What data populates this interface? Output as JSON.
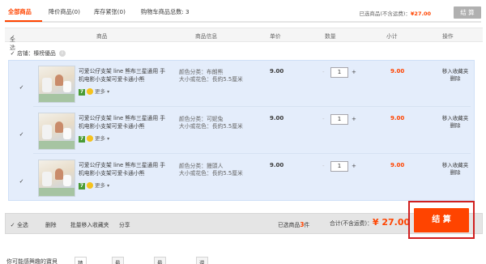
{
  "tabs": [
    {
      "label": "全部商品"
    },
    {
      "label": "降价商品(0)"
    },
    {
      "label": "库存紧张(0)"
    },
    {
      "label": "购物车商品总数: 3"
    }
  ],
  "summary": {
    "label": "已选商品(不含运费)：",
    "amount": "¥27.00",
    "pay": "结 算"
  },
  "thead": {
    "select_all": "全选",
    "product": "商品",
    "info": "商品信息",
    "price": "单价",
    "qty": "数量",
    "subtotal": "小计",
    "ops": "操作"
  },
  "shop": {
    "label": "店铺：榛榜優品",
    "tag": "i"
  },
  "item_common": {
    "more": "更多",
    "badge_seven": "7",
    "move_fav": "移入收藏夹",
    "delete": "删除"
  },
  "items": [
    {
      "title": "可爱公仔支架 line 熊布三星通用 手机电影小支架可爱卡通小熊",
      "color": "颜色分类：布朗熊",
      "size": "大小或花色：長約5.5厘米",
      "price": "9.00",
      "qty": "1",
      "minus": "-",
      "plus": "+",
      "subtotal": "9.00"
    },
    {
      "title": "可爱公仔支架 line 熊布三星通用 手机电影小支架可爱卡通小熊",
      "color": "颜色分类：可妮兔",
      "size": "大小或花色：長約5.5厘米",
      "price": "9.00",
      "qty": "1",
      "minus": "-",
      "plus": "+",
      "subtotal": "9.00"
    },
    {
      "title": "可爱公仔支架 line 熊布三星通用 手机电影小支架可爱卡通小熊",
      "color": "颜色分类：饅頭人",
      "size": "大小或花色：長約5.5厘米",
      "price": "9.00",
      "qty": "1",
      "minus": "-",
      "plus": "+",
      "subtotal": "9.00"
    }
  ],
  "footer": {
    "select_all": "全选",
    "delete": "删除",
    "batch_fav": "批量移入收藏夹",
    "share": "分享",
    "selected_prefix": "已选商品",
    "selected_count": "3",
    "selected_suffix": "件",
    "total_label": "合计(不含运费)：",
    "total_amount": "¥ 27.00",
    "pay": "结 算"
  },
  "bottom": {
    "title": "你可能感興趣的寶貝",
    "tabs": [
      "猜你喜歡",
      "最近收藏的",
      "最近瀏覽的",
      "還你喜歡的"
    ]
  },
  "colors": {
    "accent": "#ff4400",
    "highlight_box": "#d02020",
    "row_bg": "#e4edfb"
  }
}
